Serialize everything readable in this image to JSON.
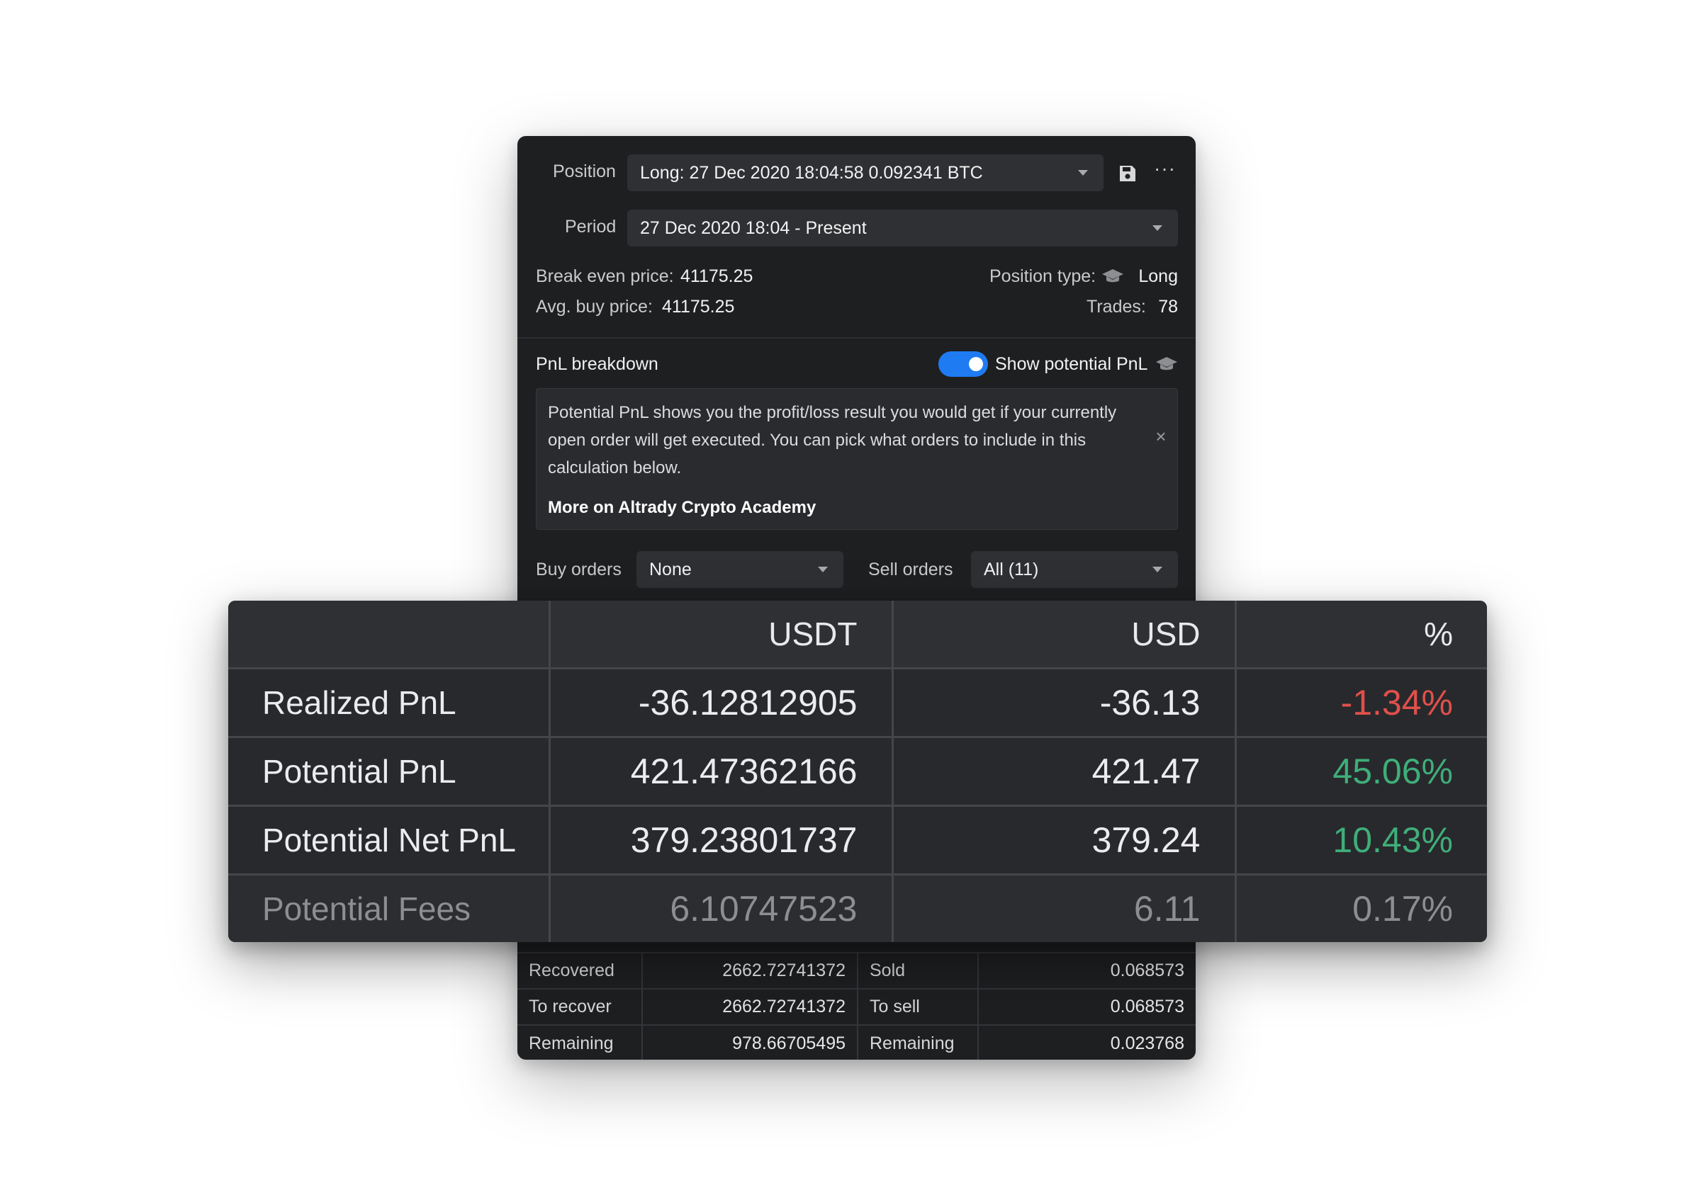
{
  "panel": {
    "position_label": "Position",
    "position_value": "Long: 27 Dec 2020 18:04:58 0.092341 BTC",
    "period_label": "Period",
    "period_value": "27 Dec 2020 18:04 - Present",
    "break_even_label": "Break even price:",
    "break_even_value": "41175.25",
    "avg_buy_label": "Avg. buy price:",
    "avg_buy_value": "41175.25",
    "position_type_label": "Position type:",
    "position_type_value": "Long",
    "trades_label": "Trades:",
    "trades_value": "78",
    "pnl_breakdown_label": "PnL breakdown",
    "show_potential_label": "Show potential PnL",
    "show_potential_on": true,
    "info_text": "Potential PnL shows you the profit/loss result you would get if your currently open order will get executed. You can pick what orders to include in this calculation below.",
    "info_link": "More on Altrady Crypto Academy",
    "buy_orders_label": "Buy orders",
    "buy_orders_value": "None",
    "sell_orders_label": "Sell orders",
    "sell_orders_value": "All (11)",
    "bottom_rows": [
      {
        "l1": "Recovered",
        "v1": "2662.72741372",
        "l2": "Sold",
        "v2": "0.068573"
      },
      {
        "l1": "To recover",
        "v1": "2662.72741372",
        "l2": "To sell",
        "v2": "0.068573"
      },
      {
        "l1": "Remaining",
        "v1": "978.66705495",
        "l2": "Remaining",
        "v2": "0.023768"
      }
    ]
  },
  "pnl_table": {
    "headers": [
      "",
      "USDT",
      "USD",
      "%"
    ],
    "rows": [
      {
        "label": "Realized PnL",
        "usdt": "-36.12812905",
        "usd": "-36.13",
        "pct": "-1.34%"
      },
      {
        "label": "Potential PnL",
        "usdt": "421.47362166",
        "usd": "421.47",
        "pct": "45.06%"
      },
      {
        "label": "Potential Net PnL",
        "usdt": "379.23801737",
        "usd": "379.24",
        "pct": "10.43%"
      },
      {
        "label": "Potential Fees",
        "usdt": "6.10747523",
        "usd": "6.11",
        "pct": "0.17%"
      }
    ]
  },
  "colors": {
    "negative": "#e0504b",
    "positive": "#3fae7a",
    "toggle_accent": "#1f7bf2"
  },
  "icons": [
    "save-icon",
    "more-icon",
    "chevron-down-icon",
    "graduation-cap-icon",
    "close-icon"
  ]
}
